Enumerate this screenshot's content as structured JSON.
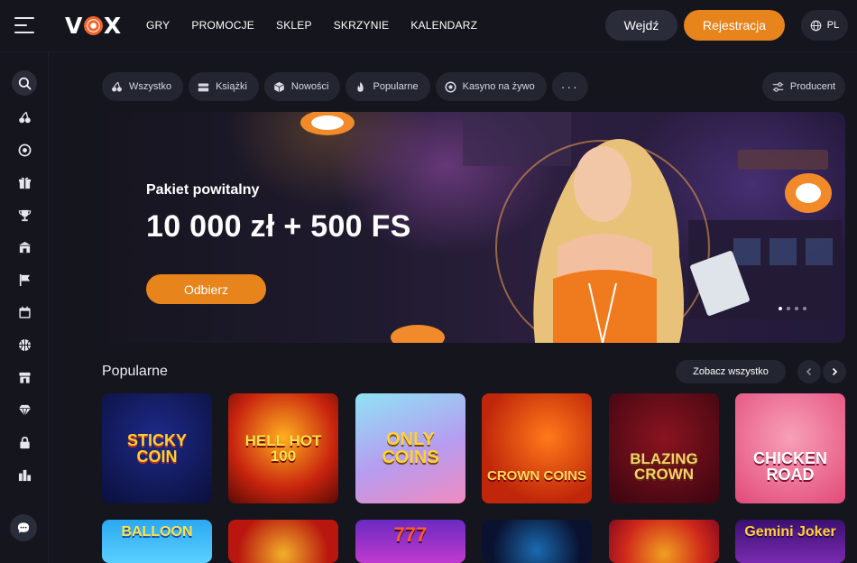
{
  "header": {
    "logo": "VOX",
    "nav": [
      "GRY",
      "PROMOCJE",
      "SKLEP",
      "SKRZYNIE",
      "KALENDARZ"
    ],
    "login_label": "Wejdź",
    "register_label": "Rejestracja",
    "language": "PL"
  },
  "sidebar": {
    "items": [
      "search-icon",
      "cherries-icon",
      "roulette-icon",
      "gift-icon",
      "trophy-icon",
      "shop-icon",
      "flag-icon",
      "calendar-icon",
      "basketball-icon",
      "store-icon",
      "diamond-icon",
      "lock-icon",
      "leaderboard-icon"
    ],
    "chat": "chat-icon"
  },
  "categories": [
    "Wszystko",
    "Książki",
    "Nowości",
    "Popularne",
    "Kasyno na żywo"
  ],
  "producer_label": "Producent",
  "hero": {
    "subtitle": "Pakiet powitalny",
    "title": "10 000 zł + 500 FS",
    "button": "Odbierz",
    "slides": 4,
    "active_slide": 1
  },
  "popular": {
    "title": "Popularne",
    "see_all": "Zobacz wszystko",
    "games": [
      "STICKY COIN",
      "HELL HOT 100",
      "ONLY COINS",
      "CROWN COINS",
      "BLAZING CROWN",
      "CHICKEN ROAD"
    ],
    "games_row2": [
      "BALLOON",
      "",
      "777",
      "",
      "",
      "Gemini Joker"
    ]
  },
  "colors": {
    "accent": "#e8841c",
    "background": "#14151d",
    "chip": "#232530"
  }
}
